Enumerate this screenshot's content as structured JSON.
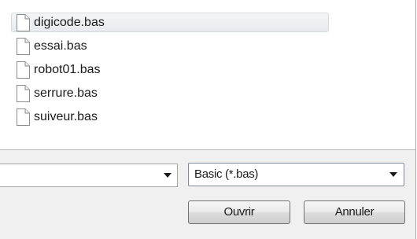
{
  "files": [
    {
      "name": "digicode.bas",
      "selected": true,
      "icon": "file-icon"
    },
    {
      "name": "essai.bas",
      "selected": false,
      "icon": "file-icon"
    },
    {
      "name": "robot01.bas",
      "selected": false,
      "icon": "file-icon"
    },
    {
      "name": "serrure.bas",
      "selected": false,
      "icon": "file-icon"
    },
    {
      "name": "suiveur.bas",
      "selected": false,
      "icon": "file-icon"
    }
  ],
  "filename_field": {
    "value": ""
  },
  "file_type_filter": {
    "selected": "Basic (*.bas)"
  },
  "buttons": {
    "open_label": "Ouvrir",
    "cancel_label": "Annuler"
  },
  "colors": {
    "selection_bg": "#e6eaee",
    "dialog_bg": "#f0f0f0"
  }
}
